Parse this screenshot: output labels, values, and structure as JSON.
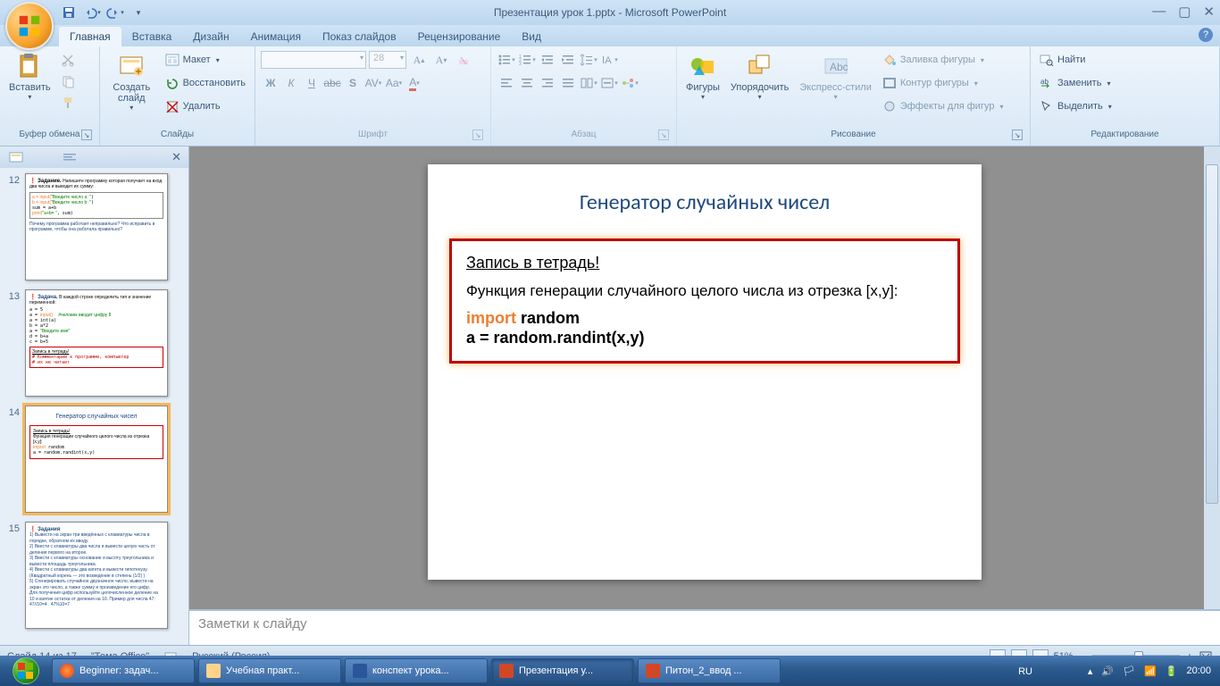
{
  "title": "Презентация урок 1.pptx - Microsoft PowerPoint",
  "qat": {
    "save": "save-icon",
    "undo": "undo-icon",
    "redo": "redo-icon"
  },
  "tabs": [
    "Главная",
    "Вставка",
    "Дизайн",
    "Анимация",
    "Показ слайдов",
    "Рецензирование",
    "Вид"
  ],
  "active_tab": 0,
  "ribbon": {
    "clipboard": {
      "label": "Буфер обмена",
      "paste": "Вставить"
    },
    "slides": {
      "label": "Слайды",
      "new": "Создать слайд",
      "layout": "Макет",
      "reset": "Восстановить",
      "delete": "Удалить"
    },
    "font": {
      "label": "Шрифт",
      "family": "",
      "size": "28"
    },
    "paragraph": {
      "label": "Абзац"
    },
    "drawing": {
      "label": "Рисование",
      "shapes": "Фигуры",
      "arrange": "Упорядочить",
      "quick": "Экспресс-стили",
      "fill": "Заливка фигуры",
      "outline": "Контур фигуры",
      "effects": "Эффекты для фигур"
    },
    "editing": {
      "label": "Редактирование",
      "find": "Найти",
      "replace": "Заменить",
      "select": "Выделить"
    }
  },
  "thumbs": {
    "visible_first": 12,
    "items": [
      {
        "n": 12,
        "hint": "Задание. Напишите программу..."
      },
      {
        "n": 13,
        "hint": "Задача. В каждой строке определить тип..."
      },
      {
        "n": 14,
        "hint": "Генератор случайных чисел",
        "selected": true
      },
      {
        "n": 15,
        "hint": "Задания"
      }
    ]
  },
  "slide": {
    "title": "Генератор случайных чисел",
    "box_header": "Запись в тетрадь!",
    "box_text": "Функция генерации случайного целого числа из отрезка [x,y]:",
    "code_kw": "import",
    "code_l1": " random",
    "code_l2": "a = random.randint(x,y)"
  },
  "notes_placeholder": "Заметки к слайду",
  "status": {
    "slide": "Слайд 14 из 17",
    "theme": "\"Тема Office\"",
    "lang": "Русский (Россия)",
    "zoom": "51%"
  },
  "taskbar": {
    "items": [
      {
        "label": "Beginner: задач...",
        "icon": "firefox"
      },
      {
        "label": "Учебная практ...",
        "icon": "folder"
      },
      {
        "label": "конспект урока...",
        "icon": "word"
      },
      {
        "label": "Презентация у...",
        "icon": "ppt",
        "active": true
      },
      {
        "label": "Питон_2_ввод ...",
        "icon": "ppt"
      }
    ],
    "lang": "RU",
    "time": "20:00"
  }
}
